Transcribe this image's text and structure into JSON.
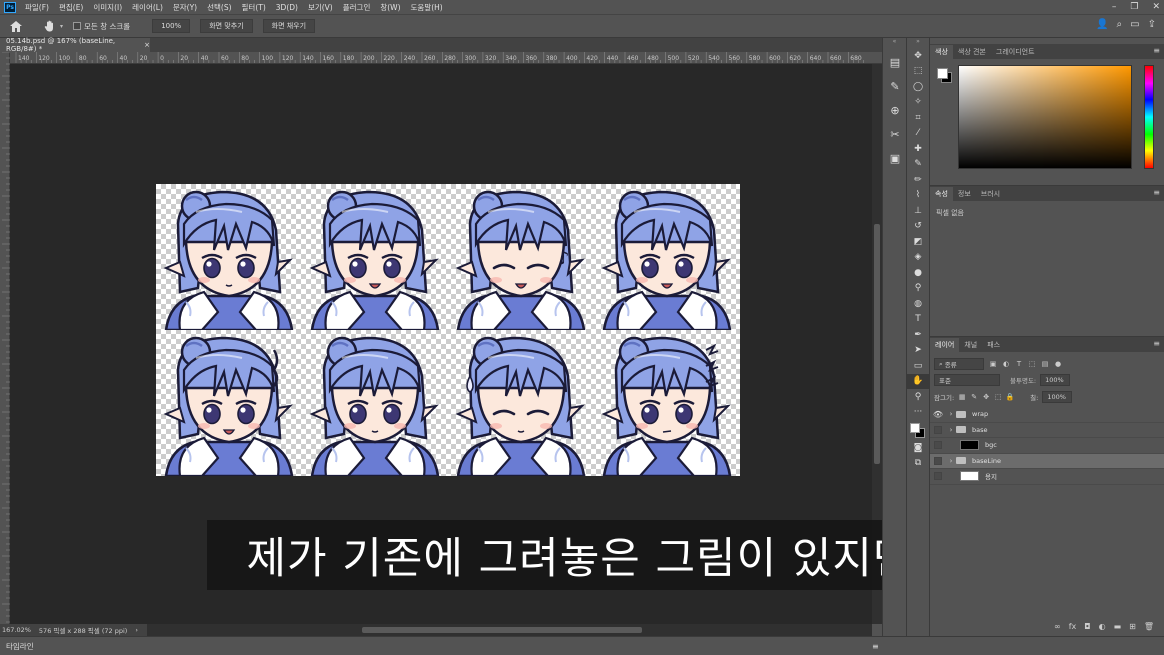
{
  "app": {
    "logo": "Ps",
    "menu": [
      "파일(F)",
      "편집(E)",
      "이미지(I)",
      "레이어(L)",
      "문자(Y)",
      "선택(S)",
      "필터(T)",
      "3D(D)",
      "보기(V)",
      "플러그인",
      "창(W)",
      "도움말(H)"
    ]
  },
  "window_controls": {
    "minimize": "–",
    "restore": "❐",
    "close": "✕"
  },
  "options_bar": {
    "home_icon": "home-icon",
    "tool_icon": "hand-icon",
    "all_windows_label": "모든 창 스크롤",
    "zoom_value": "100%",
    "fit_screen_button": "화면 맞추기",
    "fill_screen_button": "화면 채우기"
  },
  "document": {
    "tab_title": "05.14b.psd @ 167% (baseLine, RGB/8#) *",
    "close_glyph": "×",
    "zoom_status": "167.02%",
    "size_status": "576 픽셀 x 288 픽셀 (72 ppi)"
  },
  "ruler": {
    "labels": [
      "140",
      "120",
      "100",
      "80",
      "60",
      "40",
      "20",
      "0",
      "20",
      "40",
      "60",
      "80",
      "100",
      "120",
      "140",
      "160",
      "180",
      "200",
      "220",
      "240",
      "260",
      "280",
      "300",
      "320",
      "340",
      "360",
      "380",
      "400",
      "420",
      "440",
      "460",
      "480",
      "500",
      "520",
      "540",
      "560",
      "580",
      "600",
      "620",
      "640",
      "660",
      "680"
    ]
  },
  "subtitle": "제가 기존에 그려놓은 그림이 있지만",
  "timeline": {
    "label": "타임라인",
    "menu": "≡"
  },
  "panels": {
    "color_tabs": [
      "색상",
      "색상 견본",
      "그레이디언트"
    ],
    "props_tabs": [
      "속성",
      "정보",
      "브러시"
    ],
    "props_subtitle": "픽셀 없음",
    "layers_tabs": [
      "레이어",
      "채널",
      "패스"
    ],
    "kind_filter": "종류",
    "blend_mode": "표준",
    "opacity_label": "불투명도:",
    "opacity_value": "100%",
    "lock_label": "잠그기:",
    "fill_label": "칠:",
    "fill_value": "100%",
    "menu_glyph": "≡"
  },
  "layers": [
    {
      "name": "wrap",
      "type": "group",
      "visible": true,
      "selected": false
    },
    {
      "name": "base",
      "type": "group",
      "visible": false,
      "selected": false
    },
    {
      "name": "bgc",
      "type": "pixel",
      "visible": false,
      "selected": false,
      "thumb_color": "#000000"
    },
    {
      "name": "baseLine",
      "type": "group",
      "visible": false,
      "selected": true
    },
    {
      "name": "용지",
      "type": "pixel",
      "visible": false,
      "selected": false,
      "thumb_color": "#ffffff"
    }
  ],
  "sprites": [
    {
      "expression": "neutral"
    },
    {
      "expression": "talking"
    },
    {
      "expression": "smile-closed-eyes"
    },
    {
      "expression": "talking"
    },
    {
      "expression": "surprised"
    },
    {
      "expression": "neutral"
    },
    {
      "expression": "closed-eyes-sweat"
    },
    {
      "expression": "annoyed"
    }
  ],
  "colors": {
    "hair": "#8fa3e6",
    "hair_shadow": "#5f72c2",
    "outline": "#1b1b38",
    "skin": "#fce8dc",
    "blush": "#f7b8b0",
    "coat": "#6a7cd3",
    "fur": "#ffffff",
    "fur_shadow": "#b7c4ee",
    "eyes": "#3d3773",
    "ui_bg": "#535353",
    "canvas_bg": "#282828",
    "hue_accent": "#ff9800"
  }
}
